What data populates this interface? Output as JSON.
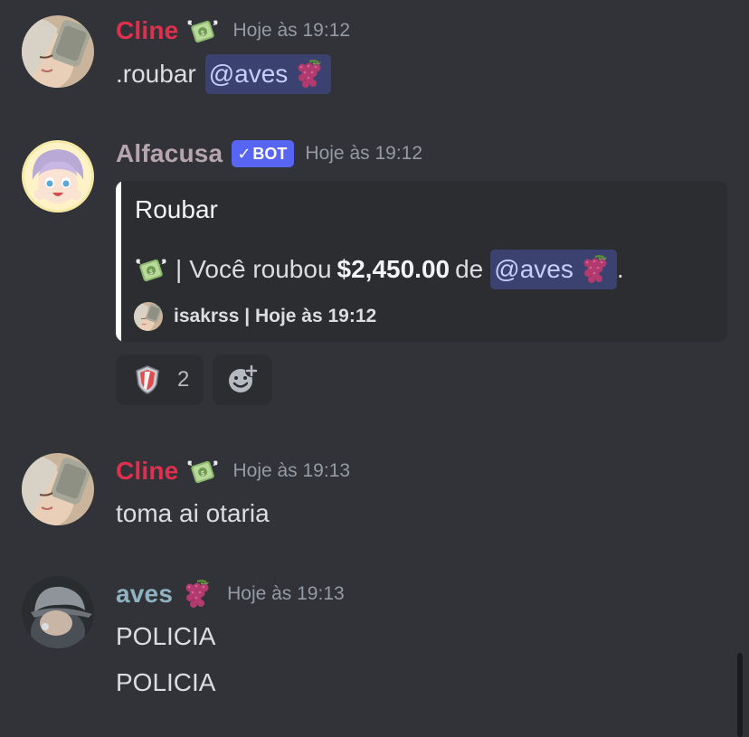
{
  "messages": {
    "m1": {
      "author": "Cline",
      "author_emoji": "money-with-wings-icon",
      "timestamp": "Hoje às 19:12",
      "text": ".roubar",
      "mention": "@aves"
    },
    "m2": {
      "author": "Alfacusa",
      "bot_tag": "BOT",
      "timestamp": "Hoje às 19:12",
      "embed": {
        "title": "Roubar",
        "desc_separator": "|",
        "desc_prefix": "Você roubou",
        "amount": "$2,450.00",
        "desc_middle": "de",
        "mention": "@aves",
        "desc_end": ".",
        "footer": "isakrss | Hoje às 19:12"
      },
      "reactions": [
        {
          "icon": "shield-badge-icon",
          "count": "2"
        }
      ]
    },
    "m3": {
      "author": "Cline",
      "timestamp": "Hoje às 19:13",
      "text": "toma ai otaria"
    },
    "m4": {
      "author": "aves",
      "author_emoji": "grapes-icon",
      "timestamp": "Hoje às 19:13",
      "lines": [
        "POLICIA",
        "POLICIA"
      ]
    }
  },
  "colors": {
    "background": "#313338",
    "cline_name": "#e0304e",
    "alfacusa_name": "#b7a5ad",
    "aves_name": "#8fb3c0",
    "bot_tag": "#5865f2",
    "mention_bg": "#3c4270",
    "embed_bg": "#2b2d31",
    "embed_bar": "#ffffff"
  }
}
